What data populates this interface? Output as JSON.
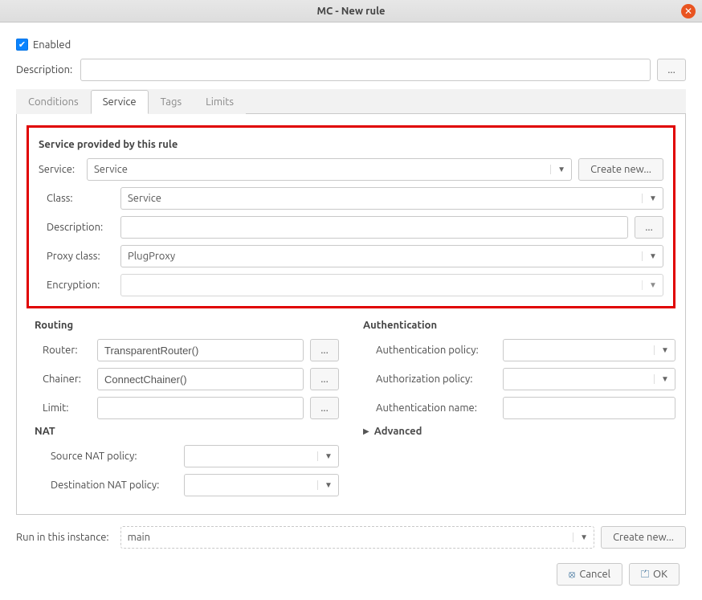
{
  "window": {
    "title": "MC - New rule"
  },
  "enabled": {
    "label": "Enabled",
    "checked": true
  },
  "description": {
    "label": "Description:",
    "value": "",
    "ellipsis": "..."
  },
  "tabs": {
    "conditions": "Conditions",
    "service": "Service",
    "tags": "Tags",
    "limits": "Limits",
    "active": "service"
  },
  "service_section": {
    "title": "Service provided by this rule",
    "service": {
      "label": "Service:",
      "value": "Service",
      "create_new": "Create new..."
    },
    "class": {
      "label": "Class:",
      "value": "Service"
    },
    "desc": {
      "label": "Description:",
      "value": "",
      "ellipsis": "..."
    },
    "proxy": {
      "label": "Proxy class:",
      "value": "PlugProxy"
    },
    "encryption": {
      "label": "Encryption:",
      "value": ""
    }
  },
  "routing": {
    "title": "Routing",
    "router": {
      "label": "Router:",
      "value": "TransparentRouter()",
      "ellipsis": "..."
    },
    "chainer": {
      "label": "Chainer:",
      "value": "ConnectChainer()",
      "ellipsis": "..."
    },
    "limit": {
      "label": "Limit:",
      "value": "",
      "ellipsis": "..."
    }
  },
  "nat": {
    "title": "NAT",
    "src": {
      "label": "Source NAT policy:",
      "value": ""
    },
    "dst": {
      "label": "Destination NAT policy:",
      "value": ""
    }
  },
  "auth": {
    "title": "Authentication",
    "authn_policy": {
      "label": "Authentication policy:",
      "value": ""
    },
    "authz_policy": {
      "label": "Authorization policy:",
      "value": ""
    },
    "authn_name": {
      "label": "Authentication name:",
      "value": ""
    }
  },
  "advanced": {
    "title": "Advanced"
  },
  "instance": {
    "label": "Run in this instance:",
    "value": "main",
    "create_new": "Create new..."
  },
  "buttons": {
    "cancel": "Cancel",
    "ok": "OK"
  }
}
